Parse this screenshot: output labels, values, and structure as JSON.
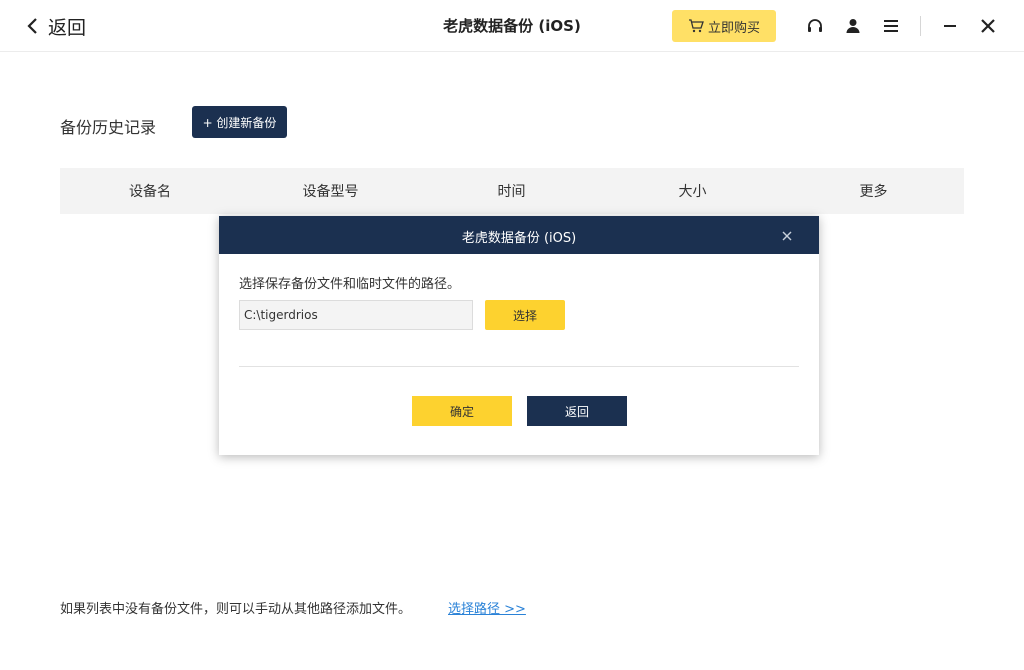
{
  "titlebar": {
    "back_label": "返回",
    "app_title": "老虎数据备份 (iOS)",
    "buy_label": "立即购买",
    "icons": [
      "chevron-left-icon",
      "cart-icon",
      "headset-icon",
      "user-icon",
      "menu-icon",
      "minimize-icon",
      "close-icon"
    ]
  },
  "main": {
    "section_title": "备份历史记录",
    "create_button": "+ 创建新备份",
    "table_columns": [
      "设备名",
      "设备型号",
      "时间",
      "大小",
      "更多"
    ]
  },
  "dialog": {
    "title": "老虎数据备份 (iOS)",
    "prompt": "选择保存备份文件和临时文件的路径。",
    "path_value": "C:\\tigerdrios",
    "choose_button": "选择",
    "ok_button": "确定",
    "back_button": "返回"
  },
  "footer": {
    "note": "如果列表中没有备份文件，则可以手动从其他路径添加文件。",
    "link": "选择路径 >>"
  },
  "colors": {
    "navy": "#1b3050",
    "yellow": "#fdd22f",
    "buy_yellow": "#ffe066",
    "link_blue": "#2a82d7"
  }
}
